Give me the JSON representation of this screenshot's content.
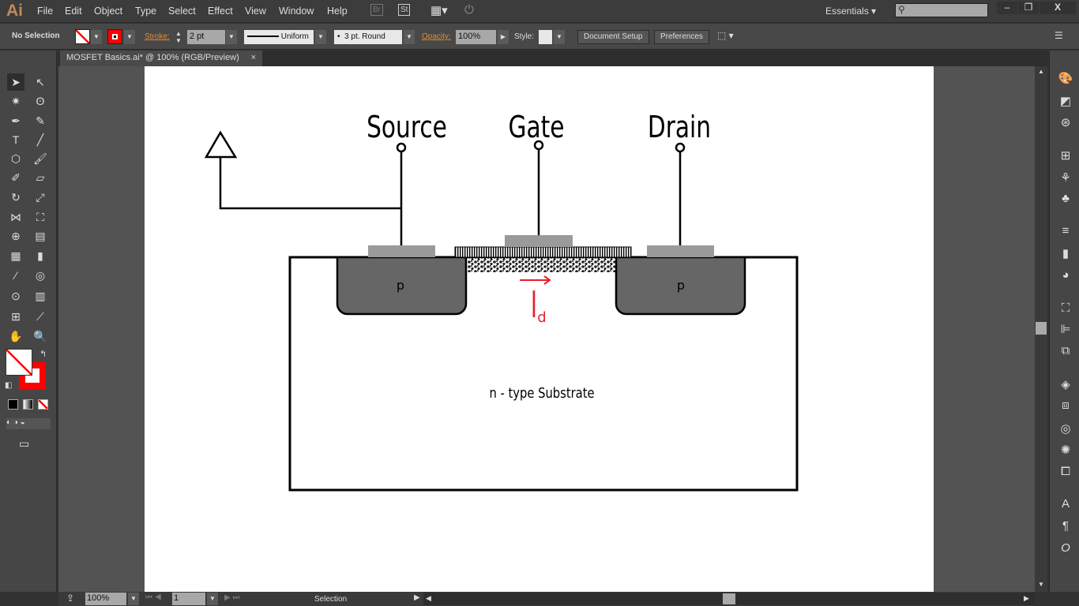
{
  "app": {
    "logo": "Ai",
    "menu": [
      "File",
      "Edit",
      "Object",
      "Type",
      "Select",
      "Effect",
      "View",
      "Window",
      "Help"
    ],
    "bridge": "Br",
    "stock": "St",
    "workspace": "Essentials",
    "search_placeholder": ""
  },
  "control": {
    "selection": "No Selection",
    "stroke_label": "Stroke:",
    "stroke_weight": "2 pt",
    "profile": "Uniform",
    "brush": "3 pt. Round",
    "opacity_label": "Opacity:",
    "opacity": "100%",
    "style_label": "Style:",
    "document_setup": "Document Setup",
    "preferences": "Preferences"
  },
  "document": {
    "tab": "MOSFET Basics.ai* @ 100% (RGB/Preview)"
  },
  "status": {
    "zoom": "100%",
    "artboard": "1",
    "tool": "Selection"
  },
  "colors": {
    "accent": "#e58c2c",
    "stroke": "#ff0000",
    "current": "#ff0000"
  },
  "diagram": {
    "source": "Source",
    "gate": "Gate",
    "drain": "Drain",
    "p_left": "p",
    "p_right": "p",
    "current": "I",
    "current_sub": "d",
    "substrate": "n - type Substrate"
  }
}
